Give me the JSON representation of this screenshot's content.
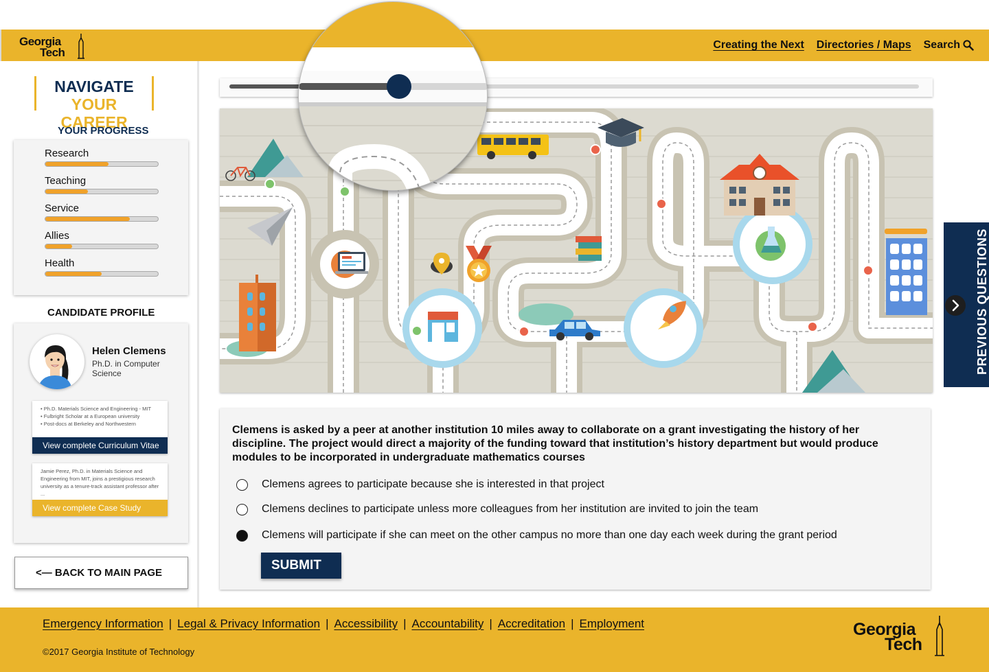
{
  "header": {
    "logo_line1": "Georgia",
    "logo_line2": "Tech",
    "links": [
      "Creating the Next",
      "Directories / Maps"
    ],
    "search_label": "Search"
  },
  "sidebar": {
    "title_line1": "NAVIGATE",
    "title_line2": "YOUR CAREER",
    "progress_heading": "YOUR PROGRESS",
    "progress": [
      {
        "label": "Research",
        "value": 0.56
      },
      {
        "label": "Teaching",
        "value": 0.38
      },
      {
        "label": "Service",
        "value": 0.75
      },
      {
        "label": "Allies",
        "value": 0.24
      },
      {
        "label": "Health",
        "value": 0.5
      }
    ],
    "profile_heading": "CANDIDATE PROFILE",
    "profile": {
      "name": "Helen Clemens",
      "degree": "Ph.D. in Computer Science",
      "cv_lines": [
        "• Ph.D.  Materials Science and Engineering - MIT",
        "• Fulbright Scholar at a European university",
        "• Post-docs at Berkeley and Northwestern"
      ],
      "cv_button": "View complete Curriculum Vitae",
      "case_text": "Jamie Perez, Ph.D. in Materials Science and Engineering from MIT, joins a prestigious research university as a tenure-track assistant professor after ...",
      "case_button": "View complete Case Study"
    },
    "back_button": "<— BACK TO MAIN PAGE"
  },
  "slider": {
    "value": 0.24
  },
  "question": {
    "text": "Clemens is asked by a peer at another institution 10 miles away to collaborate on a grant investigating the history of her discipline. The project would direct a majority of the funding toward that institution’s history department but would produce modules to be incorporated in undergraduate mathematics courses",
    "options": [
      "Clemens agrees to participate because she is interested in that project",
      "Clemens declines to participate unless more colleagues from her institution are invited to join the team",
      "Clemens will participate if she can meet on the other campus no more than one day each week during the grant period"
    ],
    "selected_index": 2,
    "submit_label": "SUBMIT"
  },
  "previous_questions_label": "PREVIOUS QUESTIONS",
  "footer": {
    "links": [
      "Emergency Information",
      "Legal & Privacy Information",
      "Accessibility",
      "Accountability",
      "Accreditation",
      "Employment"
    ],
    "copyright": "©2017 Georgia Institute of Technology",
    "logo_line1": "Georgia",
    "logo_line2": "Tech"
  },
  "colors": {
    "gold": "#eab42b",
    "navy": "#0f2d52",
    "progress_fill": "#f0a22a"
  },
  "icons": [
    "search-icon",
    "chevron-right-icon",
    "bicycle-icon",
    "paper-plane-icon",
    "bus-icon",
    "graduation-cap-icon",
    "school-building-icon",
    "laptop-icon",
    "medal-icon",
    "location-pin-icon",
    "books-icon",
    "flask-icon",
    "store-icon",
    "car-icon",
    "rocket-icon",
    "office-building-icon"
  ]
}
